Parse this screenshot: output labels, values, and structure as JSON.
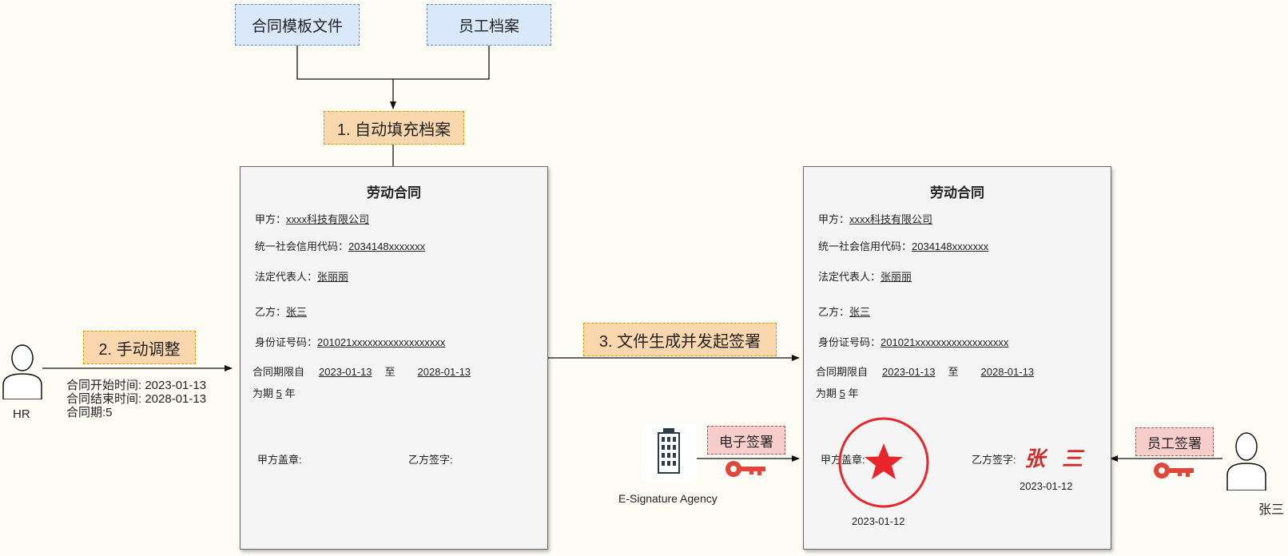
{
  "inputs": {
    "template_file": "合同模板文件",
    "employee_archive": "员工档案"
  },
  "steps": {
    "step1": "1. 自动填充档案",
    "step2": "2. 手动调整",
    "step3": "3. 文件生成并发起签署"
  },
  "hr": {
    "label": "HR",
    "notes": [
      "合同开始时间: 2023-01-13",
      "合同结束时间: 2028-01-13",
      "合同期:5"
    ]
  },
  "contract": {
    "title": "劳动合同",
    "party_a_label": "甲方：",
    "party_a_value": "xxxx科技有限公司",
    "credit_code_label": "统一社会信用代码：",
    "credit_code_value": "2034148xxxxxxx",
    "legal_rep_label": "法定代表人：",
    "legal_rep_value": "张丽丽",
    "party_b_label": "乙方：",
    "party_b_value": "张三",
    "id_label": "身份证号码：",
    "id_value": "201021xxxxxxxxxxxxxxxxxx",
    "term_label": "合同期限自",
    "start_date": "2023-01-13",
    "to_label": "至",
    "end_date": "2028-01-13",
    "period_prefix": "为期",
    "period_years": "5",
    "period_suffix": "年",
    "seal_label": "甲方盖章:",
    "sign_label": "乙方签字:"
  },
  "signing": {
    "esig_label": "电子签署",
    "agency_label": "E-Signature Agency",
    "employee_sign_label": "员工签署",
    "employee_name": "张三",
    "seal_date": "2023-01-12",
    "signature_text": "张 三",
    "sign_date": "2023-01-12"
  },
  "colors": {
    "seal_red": "#e8252a",
    "key_red": "#e0473a"
  }
}
